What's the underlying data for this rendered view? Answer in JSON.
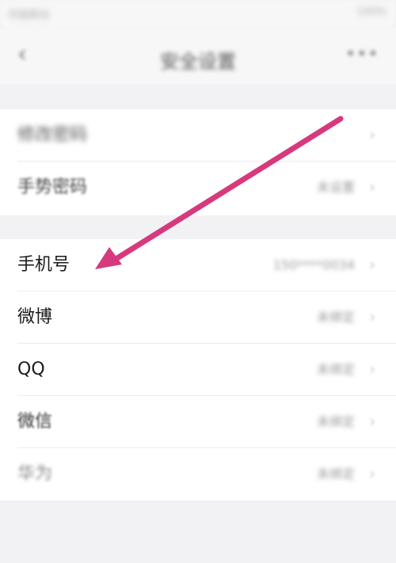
{
  "status_bar": {
    "left_text": "中国移动",
    "right_text": "100%"
  },
  "header": {
    "back_icon": "‹",
    "title": "安全设置",
    "more_icon": "•••"
  },
  "group1": {
    "rows": [
      {
        "label": "修改密码",
        "value": "",
        "chevron": "›"
      },
      {
        "label": "手势密码",
        "value": "未设置",
        "chevron": "›"
      }
    ]
  },
  "group2": {
    "rows": [
      {
        "label": "手机号",
        "value": "150****0034",
        "chevron": "›"
      },
      {
        "label": "微博",
        "value": "未绑定",
        "chevron": "›"
      },
      {
        "label": "QQ",
        "value": "未绑定",
        "chevron": "›"
      },
      {
        "label": "微信",
        "value": "未绑定",
        "chevron": "›"
      },
      {
        "label": "华为",
        "value": "未绑定",
        "chevron": "›"
      }
    ]
  },
  "annotation": {
    "arrow_color": "#d63a7d"
  }
}
